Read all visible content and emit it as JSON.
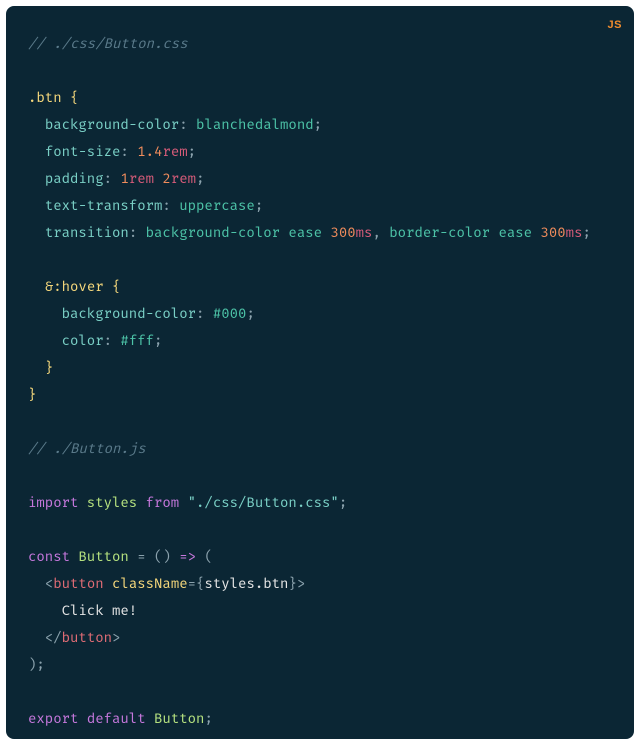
{
  "badge": "JS",
  "code": {
    "l01_comment": "// ./css/Button.css",
    "l02_selector": ".btn",
    "l02_brace": " {",
    "l03_prop": "background-color",
    "l03_colon": ": ",
    "l03_value": "blanchedalmond",
    "l03_semi": ";",
    "l04_prop": "font-size",
    "l04_colon": ": ",
    "l04_num": "1.4",
    "l04_unit": "rem",
    "l04_semi": ";",
    "l05_prop": "padding",
    "l05_colon": ": ",
    "l05_num1": "1",
    "l05_unit1": "rem",
    "l05_sp": " ",
    "l05_num2": "2",
    "l05_unit2": "rem",
    "l05_semi": ";",
    "l06_prop": "text-transform",
    "l06_colon": ": ",
    "l06_value": "uppercase",
    "l06_semi": ";",
    "l07_prop": "transition",
    "l07_colon": ": ",
    "l07_v1": "background-color ease ",
    "l07_n1": "300",
    "l07_u1": "ms",
    "l07_comma": ", ",
    "l07_v2": "border-color ease ",
    "l07_n2": "300",
    "l07_u2": "ms",
    "l07_semi": ";",
    "l08_amp": "&",
    "l08_pseudo": ":hover",
    "l08_brace": " {",
    "l09_prop": "background-color",
    "l09_colon": ": ",
    "l09_value": "#000",
    "l09_semi": ";",
    "l10_prop": "color",
    "l10_colon": ": ",
    "l10_value": "#fff",
    "l10_semi": ";",
    "l11_close": "}",
    "l12_close": "}",
    "l13_comment": "// ./Button.js",
    "l14_import": "import",
    "l14_styles": " styles ",
    "l14_from": "from",
    "l14_sp": " ",
    "l14_str": "\"./css/Button.css\"",
    "l14_semi": ";",
    "l15_const": "const",
    "l15_sp1": " ",
    "l15_name": "Button",
    "l15_sp2": " ",
    "l15_eq": "=",
    "l15_sp3": " ",
    "l15_paren1": "(",
    "l15_paren2": ")",
    "l15_sp4": " ",
    "l15_arrow": "=>",
    "l15_sp5": " ",
    "l15_open": "(",
    "l16_lt": "<",
    "l16_tag": "button",
    "l16_sp": " ",
    "l16_attr": "className",
    "l16_eq": "=",
    "l16_lb": "{",
    "l16_expr": "styles.btn",
    "l16_rb": "}",
    "l16_gt": ">",
    "l17_text": "Click me!",
    "l18_lts": "</",
    "l18_tag": "button",
    "l18_gt": ">",
    "l19_close": ")",
    "l19_semi": ";",
    "l20_export": "export",
    "l20_sp1": " ",
    "l20_default": "default",
    "l20_sp2": " ",
    "l20_name": "Button",
    "l20_semi": ";"
  }
}
